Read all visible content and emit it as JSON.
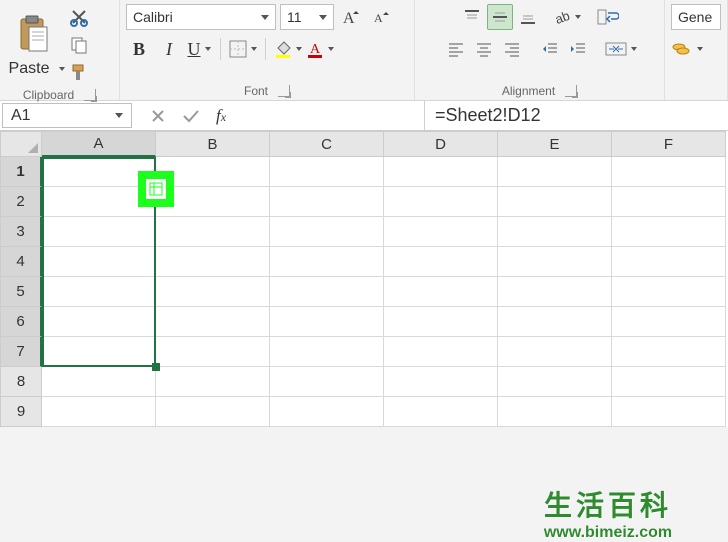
{
  "ribbon": {
    "clipboard": {
      "paste_label": "Paste",
      "group_label": "Clipboard"
    },
    "font": {
      "font_name": "Calibri",
      "font_size": "11",
      "bold": "B",
      "italic": "I",
      "underline": "U",
      "group_label": "Font"
    },
    "alignment": {
      "group_label": "Alignment"
    },
    "number": {
      "format": "Gene"
    }
  },
  "formula_bar": {
    "name_box": "A1",
    "formula": "=Sheet2!D12"
  },
  "grid": {
    "columns": [
      "A",
      "B",
      "C",
      "D",
      "E",
      "F"
    ],
    "rows": [
      "1",
      "2",
      "3",
      "4",
      "5",
      "6",
      "7",
      "8",
      "9"
    ],
    "selected_col": "A",
    "selected_rows_through": 7,
    "active_cell": "A1"
  },
  "watermark": {
    "text_cn": "生活百科",
    "url": "www.bimeiz.com"
  }
}
